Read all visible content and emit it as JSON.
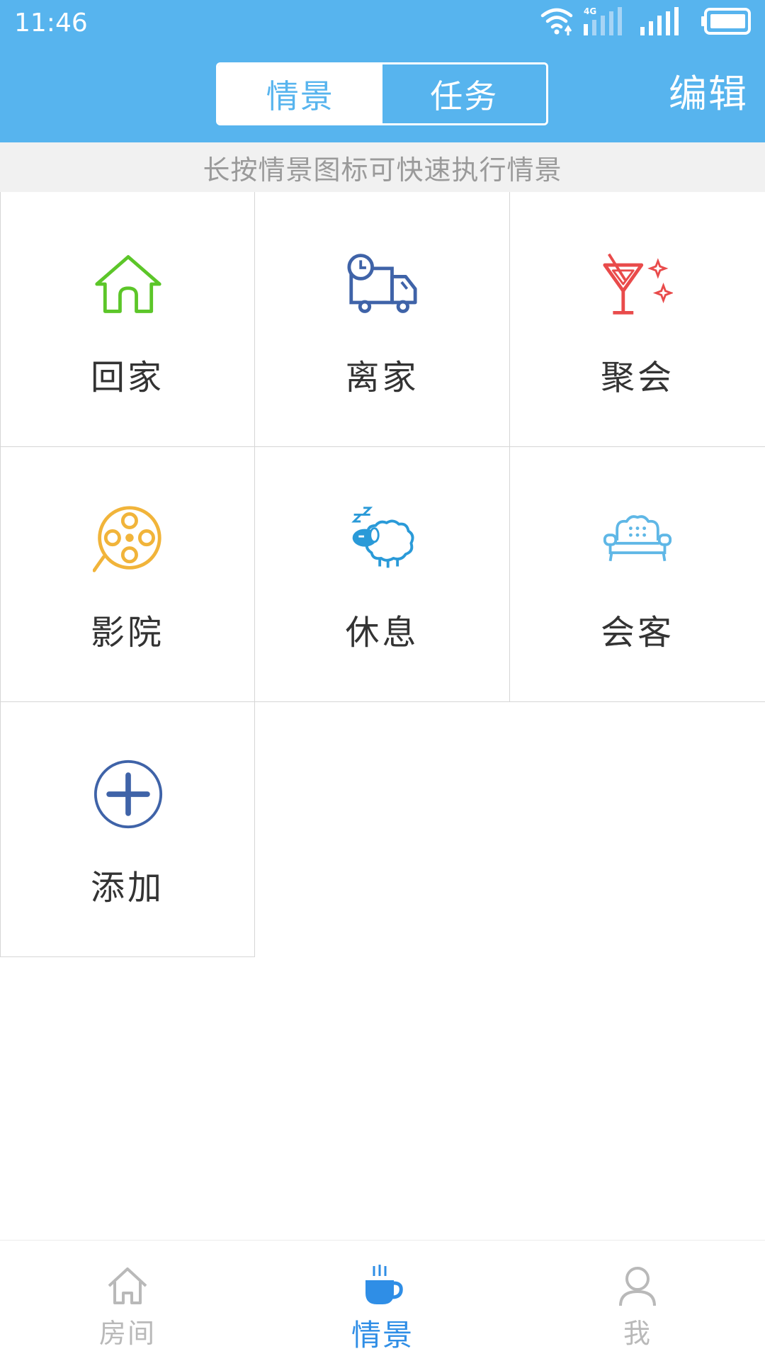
{
  "status_bar": {
    "time": "11:46",
    "network_type": "4G",
    "icons": [
      "wifi-icon",
      "signal-4g-icon",
      "signal-icon",
      "battery-icon"
    ]
  },
  "header": {
    "tabs": [
      {
        "label": "情景",
        "active": true
      },
      {
        "label": "任务",
        "active": false
      }
    ],
    "edit_label": "编辑"
  },
  "hint": "长按情景图标可快速执行情景",
  "scenes": [
    {
      "label": "回家",
      "icon": "home-icon",
      "color": "#5cc629"
    },
    {
      "label": "离家",
      "icon": "truck-clock-icon",
      "color": "#3f63a8"
    },
    {
      "label": "聚会",
      "icon": "cocktail-icon",
      "color": "#e94b4b"
    },
    {
      "label": "影院",
      "icon": "film-reel-icon",
      "color": "#f1b43a"
    },
    {
      "label": "休息",
      "icon": "sleeping-sheep-icon",
      "color": "#2a9ad8"
    },
    {
      "label": "会客",
      "icon": "sofa-icon",
      "color": "#5fb7e6"
    },
    {
      "label": "添加",
      "icon": "add-circle-icon",
      "color": "#3f63a8"
    }
  ],
  "tabbar": {
    "items": [
      {
        "label": "房间",
        "icon": "house-outline-icon",
        "active": false
      },
      {
        "label": "情景",
        "icon": "coffee-cup-icon",
        "active": true
      },
      {
        "label": "我",
        "icon": "user-icon",
        "active": false
      }
    ],
    "active_color": "#2f8ee6",
    "inactive_color": "#b9b9b9"
  },
  "colors": {
    "header_bg": "#57b4ee",
    "hint_bg": "#f1f1f1",
    "grid_border": "#d6d6d6"
  }
}
